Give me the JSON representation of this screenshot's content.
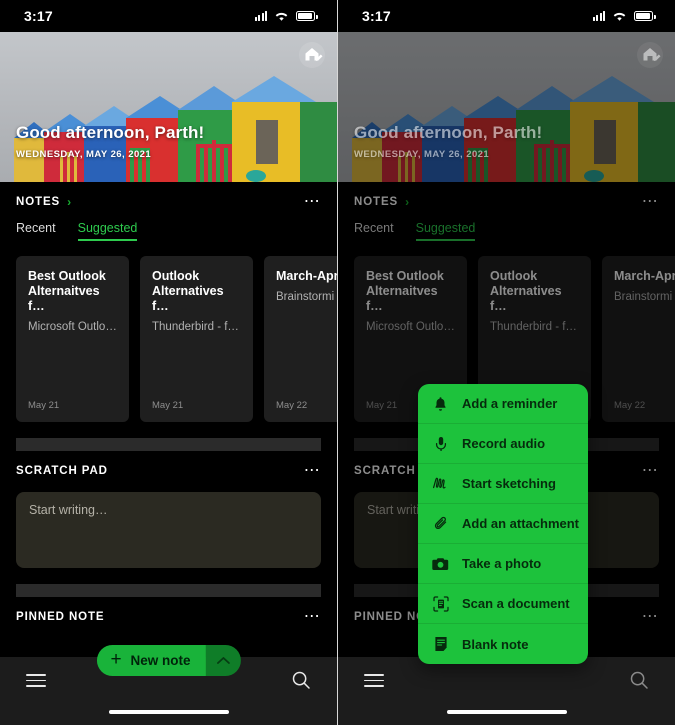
{
  "status_bar": {
    "time": "3:17",
    "signal_icon": "cellular-signal-icon",
    "wifi_icon": "wifi-icon",
    "battery_icon": "battery-icon"
  },
  "hero": {
    "greeting": "Good afternoon, Parth!",
    "date": "WEDNESDAY, MAY 26, 2021",
    "avatar_icon": "home-edit-icon"
  },
  "notes_section": {
    "title": "NOTES",
    "chevron": "›",
    "more_icon": "more-options-icon",
    "tabs": [
      {
        "label": "Recent",
        "active": false
      },
      {
        "label": "Suggested",
        "active": true
      }
    ],
    "cards": [
      {
        "title": "Best Outlook Alternaitves f…",
        "subtitle": "Microsoft Outlo…",
        "date": "May 21"
      },
      {
        "title": "Outlook Alternatives f…",
        "subtitle": "Thunderbird - f…",
        "date": "May 21"
      },
      {
        "title": "March-Apr",
        "subtitle": "Brainstormi",
        "date": "May 22"
      }
    ]
  },
  "scratch_pad": {
    "title": "SCRATCH PAD",
    "more_icon": "more-options-icon",
    "placeholder": "Start writing…"
  },
  "pinned_note": {
    "title": "PINNED NOTE",
    "more_icon": "more-options-icon"
  },
  "new_note_button": {
    "plus_icon": "plus-icon",
    "label": "New note",
    "caret_icon": "chevron-up-icon"
  },
  "bottom_nav": {
    "menu_icon": "hamburger-menu-icon",
    "search_icon": "search-icon",
    "home_indicator": "home-indicator"
  },
  "context_menu": {
    "items": [
      {
        "icon": "bell-icon",
        "label": "Add a reminder"
      },
      {
        "icon": "microphone-icon",
        "label": "Record audio"
      },
      {
        "icon": "sketch-icon",
        "label": "Start sketching"
      },
      {
        "icon": "paperclip-icon",
        "label": "Add an attachment"
      },
      {
        "icon": "camera-icon",
        "label": "Take a photo"
      },
      {
        "icon": "scan-document-icon",
        "label": "Scan a document"
      },
      {
        "icon": "blank-note-icon",
        "label": "Blank note"
      }
    ]
  },
  "colors": {
    "accent_green": "#1dc23c",
    "button_green": "#19b33a",
    "button_green_dark": "#0f7d28",
    "tab_active": "#2ecb4e",
    "background": "#000000",
    "card_bg": "#1f1f1f",
    "scratch_bg": "#2b2a22",
    "bottom_bar": "#1c1c1c"
  }
}
